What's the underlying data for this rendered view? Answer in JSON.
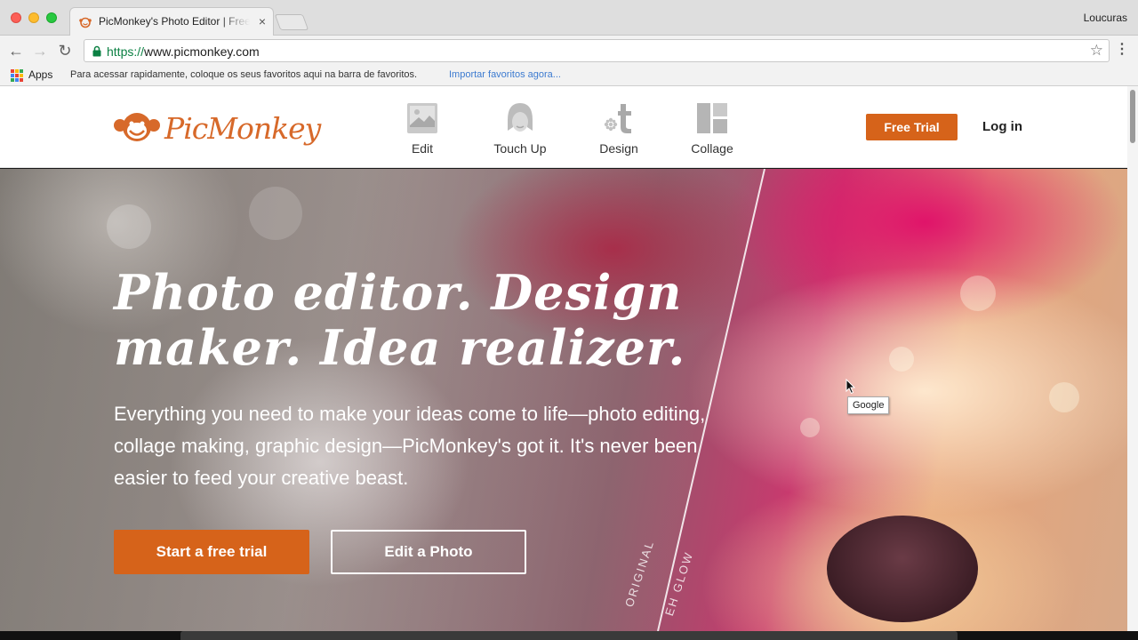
{
  "browser": {
    "tab_title": "PicMonkey's Photo Editor | Free Online Photo Editing",
    "tab_close": "×",
    "profile_name": "Loucuras",
    "url_scheme": "https://",
    "url_rest": "www.picmonkey.com",
    "nav": {
      "back": "←",
      "forward": "→",
      "reload": "↻"
    },
    "star": "☆",
    "menu": "⋮",
    "bookmarks": {
      "apps_label": "Apps",
      "hint": "Para acessar rapidamente, coloque os seus favoritos aqui na barra de favoritos.",
      "import_link": "Importar favoritos agora..."
    }
  },
  "header": {
    "logo_text": "PicMonkey",
    "nav_items": [
      {
        "label": "Edit",
        "icon": "image-icon"
      },
      {
        "label": "Touch Up",
        "icon": "face-icon"
      },
      {
        "label": "Design",
        "icon": "design-icon"
      },
      {
        "label": "Collage",
        "icon": "collage-icon"
      }
    ],
    "free_trial": "Free Trial",
    "login": "Log in"
  },
  "hero": {
    "title": "Photo editor. Design maker. Idea realizer.",
    "subtitle": "Everything you need to make your ideas come to life—photo editing, collage making, graphic design—PicMonkey's got it. It's never been easier to feed your creative beast.",
    "cta_primary": "Start a free trial",
    "cta_secondary": "Edit a Photo",
    "label_original": "ORIGINAL",
    "label_effect": "EH GLOW"
  },
  "tooltip": {
    "text": "Google"
  },
  "colors": {
    "accent": "#d6631a",
    "logo": "#d7692a",
    "url_green": "#0b8043",
    "link_blue": "#3d7bd0"
  }
}
